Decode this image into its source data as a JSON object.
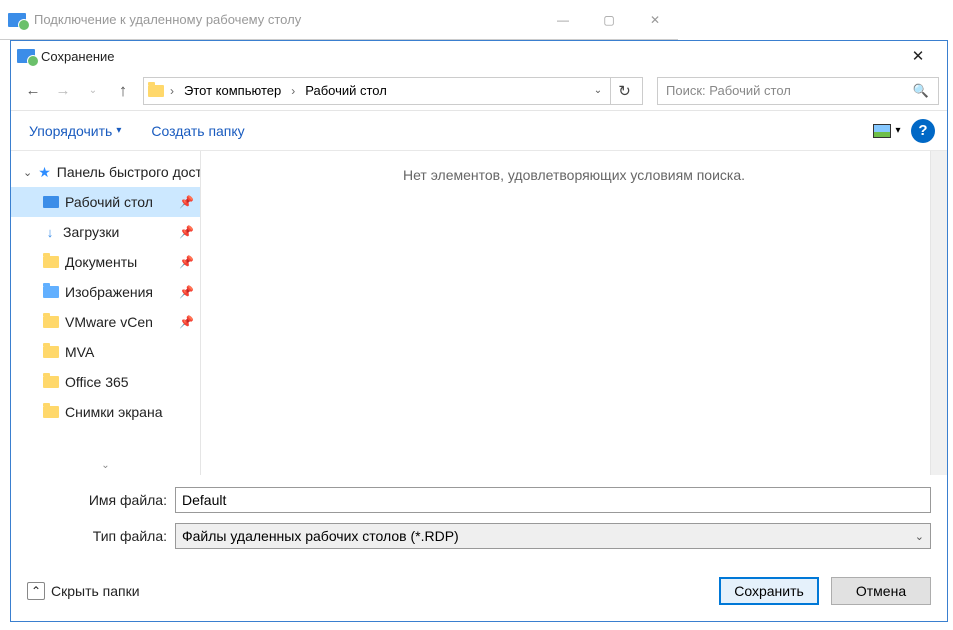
{
  "parent_window": {
    "title": "Подключение к удаленному рабочему столу"
  },
  "dialog": {
    "title": "Сохранение",
    "breadcrumb": {
      "root": "Этот компьютер",
      "current": "Рабочий стол"
    },
    "search_placeholder": "Поиск: Рабочий стол",
    "toolbar": {
      "organize": "Упорядочить",
      "new_folder": "Создать папку"
    },
    "tree": {
      "quick_access": "Панель быстрого доступа",
      "items": [
        {
          "label": "Рабочий стол",
          "pinned": true,
          "selected": true,
          "icon": "desktop"
        },
        {
          "label": "Загрузки",
          "pinned": true,
          "icon": "downloads"
        },
        {
          "label": "Документы",
          "pinned": true,
          "icon": "folder"
        },
        {
          "label": "Изображения",
          "pinned": true,
          "icon": "folder-blue"
        },
        {
          "label": "VMware vCen",
          "pinned": true,
          "icon": "folder"
        },
        {
          "label": "MVA",
          "pinned": false,
          "icon": "folder"
        },
        {
          "label": "Office 365",
          "pinned": false,
          "icon": "folder"
        },
        {
          "label": "Снимки экрана",
          "pinned": false,
          "icon": "folder"
        }
      ]
    },
    "content_empty": "Нет элементов, удовлетворяющих условиям поиска.",
    "filename_label": "Имя файла:",
    "filename_value": "Default",
    "filetype_label": "Тип файла:",
    "filetype_value": "Файлы удаленных рабочих столов (*.RDP)",
    "hide_folders": "Скрыть папки",
    "save_button": "Сохранить",
    "cancel_button": "Отмена"
  }
}
